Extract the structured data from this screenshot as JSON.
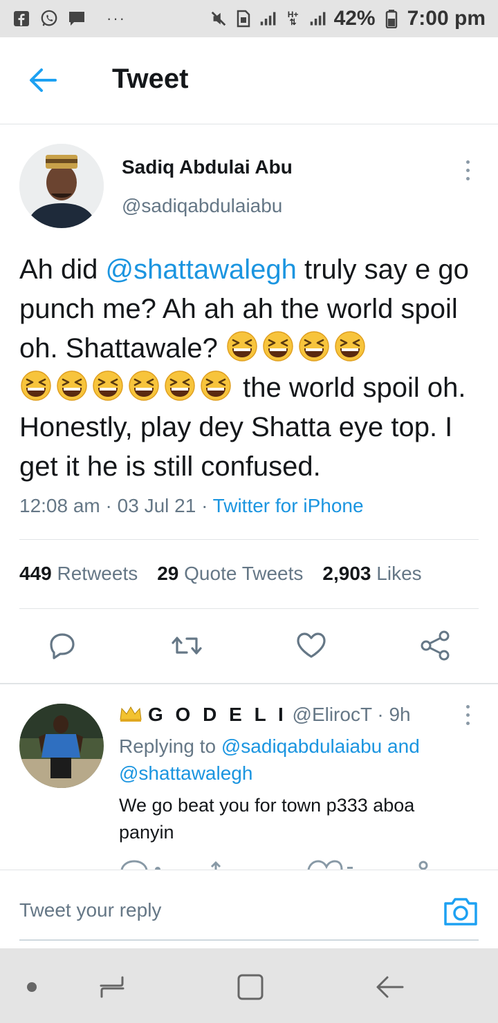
{
  "status_bar": {
    "battery": "42%",
    "time": "7:00 pm",
    "icons_left": [
      "facebook-icon",
      "whatsapp-icon",
      "message-icon"
    ],
    "icons_right": [
      "mute-icon",
      "sim-icon",
      "signal-icon",
      "ht-signal-icon",
      "signal-icon-2",
      "battery-icon"
    ]
  },
  "header": {
    "title": "Tweet"
  },
  "tweet": {
    "author_name": "Sadiq Abdulai Abu",
    "author_handle": "@sadiqabdulaiabu",
    "text_1": "Ah did ",
    "mention": "@shattawalegh",
    "text_2": " truly say e go punch me? Ah ah ah the world spoil oh. Shattawale? ",
    "emoji_count": 10,
    "text_3": " the world spoil oh. Honestly, play dey Shatta eye top. I get it he is still confused.",
    "time": "12:08 am",
    "separator": "·",
    "date": "03 Jul 21",
    "source": "Twitter for iPhone",
    "stats": {
      "retweets_count": "449",
      "retweets_label": "Retweets",
      "quotes_count": "29",
      "quotes_label": "Quote Tweets",
      "likes_count": "2,903",
      "likes_label": "Likes"
    }
  },
  "reply": {
    "display_name": "G O D E L I",
    "handle": "@ElirocT",
    "age": "· 9h",
    "replying_prefix": "Replying to ",
    "replying_to_1": "@sadiqabdulaiabu",
    "replying_and": " and ",
    "replying_to_2": "@shattawalegh",
    "text": "We go beat you for town p333 aboa panyin"
  },
  "compose": {
    "placeholder": "Tweet your reply"
  },
  "colors": {
    "accent": "#1b95e0",
    "text": "#14171a",
    "secondary": "#657786",
    "emoji": "#f7c43c"
  }
}
